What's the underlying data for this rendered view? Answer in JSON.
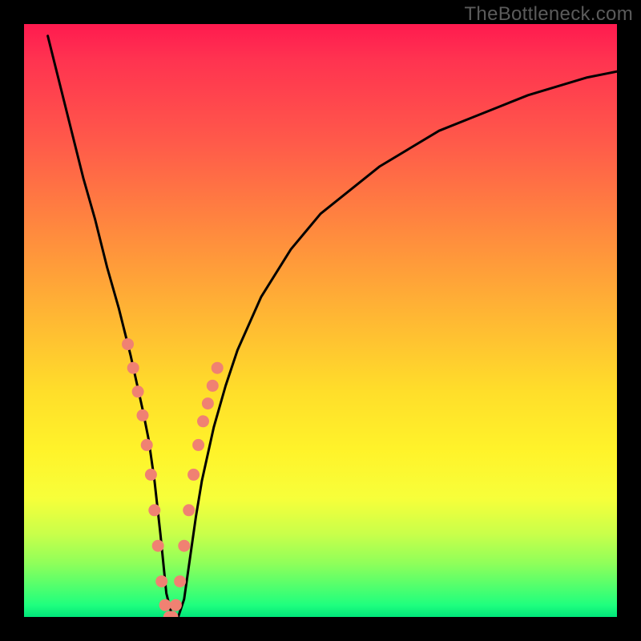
{
  "watermark": "TheBottleneck.com",
  "colors": {
    "curve": "#000000",
    "marker_fill": "#f08172",
    "marker_stroke": "#c94f49"
  },
  "chart_data": {
    "type": "line",
    "title": "",
    "xlabel": "",
    "ylabel": "",
    "xlim": [
      0,
      100
    ],
    "ylim": [
      0,
      100
    ],
    "note": "Y-axis inverted visually: y=0 is bottom (green), y=100 is top (red). Curve gives bottleneck-percentage-like value vs. an unlabeled x-axis.",
    "series": [
      {
        "name": "curve",
        "x": [
          4,
          6,
          8,
          10,
          12,
          14,
          16,
          18,
          20,
          21,
          22,
          23,
          24,
          25,
          26,
          27,
          28,
          29,
          30,
          32,
          34,
          36,
          40,
          45,
          50,
          55,
          60,
          65,
          70,
          75,
          80,
          85,
          90,
          95,
          100
        ],
        "y": [
          98,
          90,
          82,
          74,
          67,
          59,
          52,
          44,
          35,
          30,
          23,
          14,
          4,
          0,
          0,
          3,
          10,
          17,
          23,
          32,
          39,
          45,
          54,
          62,
          68,
          72,
          76,
          79,
          82,
          84,
          86,
          88,
          89.5,
          91,
          92
        ]
      }
    ],
    "markers": {
      "name": "highlighted-points",
      "x": [
        17.5,
        18.4,
        19.2,
        20.0,
        20.7,
        21.4,
        22.0,
        22.6,
        23.2,
        23.8,
        24.5,
        25.0,
        25.6,
        26.3,
        27.0,
        27.8,
        28.6,
        29.4,
        30.2,
        31.0,
        31.8,
        32.6
      ],
      "y": [
        46,
        42,
        38,
        34,
        29,
        24,
        18,
        12,
        6,
        2,
        0,
        0,
        2,
        6,
        12,
        18,
        24,
        29,
        33,
        36,
        39,
        42
      ]
    }
  }
}
